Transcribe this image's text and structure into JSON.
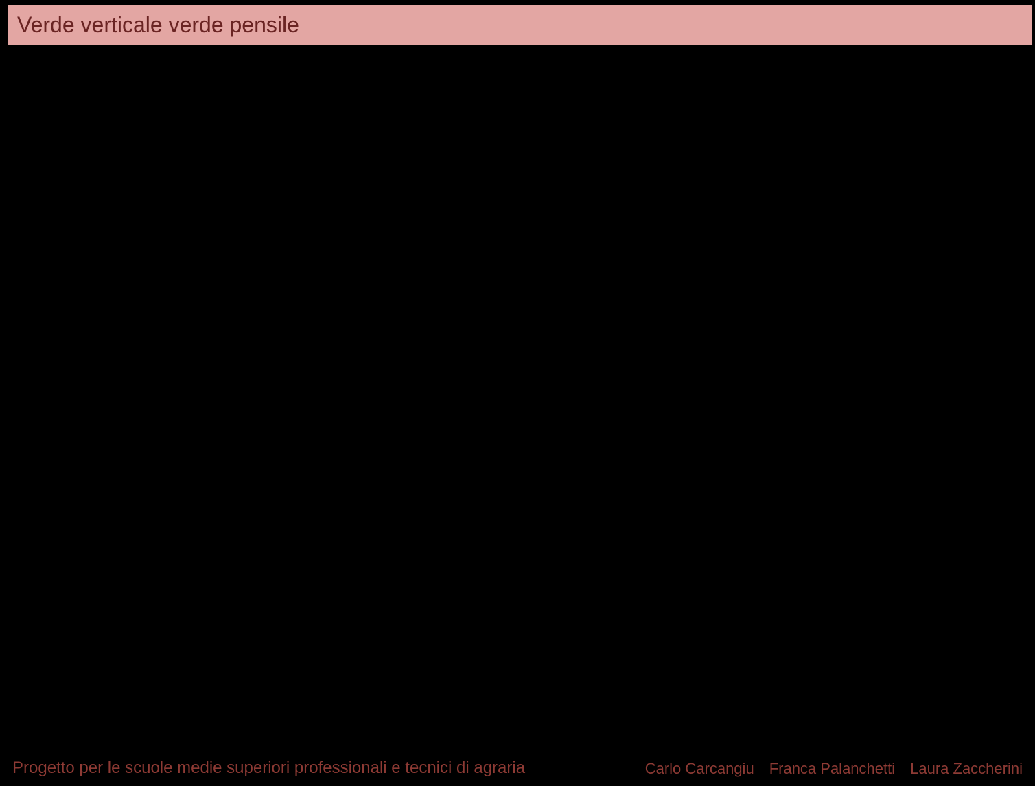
{
  "colors": {
    "background": "#000000",
    "title_bar_bg": "#e3a6a3",
    "title_text": "#6a2423",
    "footer_text": "#8d3a34"
  },
  "header": {
    "title": "Verde verticale verde pensile"
  },
  "footer": {
    "left": "Progetto per le scuole medie superiori professionali e tecnici di agraria",
    "authors": [
      "Carlo Carcangiu",
      "Franca Palanchetti",
      "Laura Zaccherini"
    ]
  }
}
